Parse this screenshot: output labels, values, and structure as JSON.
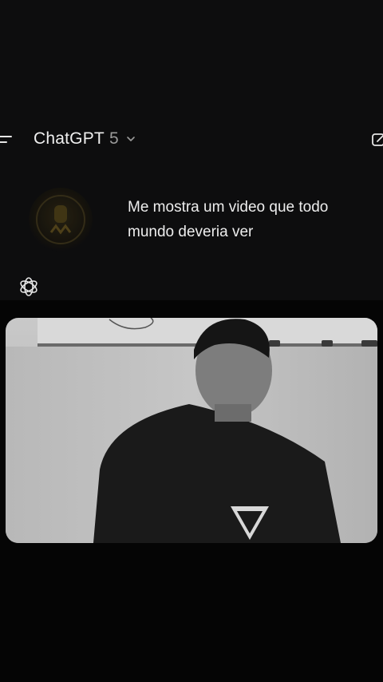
{
  "header": {
    "title": "ChatGPT",
    "version": "5",
    "icons": {
      "menu": "menu-icon",
      "chevron": "chevron-down-icon",
      "new_chat": "new-chat-icon"
    }
  },
  "conversation": {
    "user_message": "Me mostra um video que todo mundo deveria ver",
    "avatar_icon": "user-avatar",
    "assistant_icon": "openai-logo-icon"
  },
  "video": {
    "subject": "video-frame"
  },
  "colors": {
    "background": "#0d0d0e",
    "text": "#ececec",
    "muted": "#9a9a9a"
  }
}
